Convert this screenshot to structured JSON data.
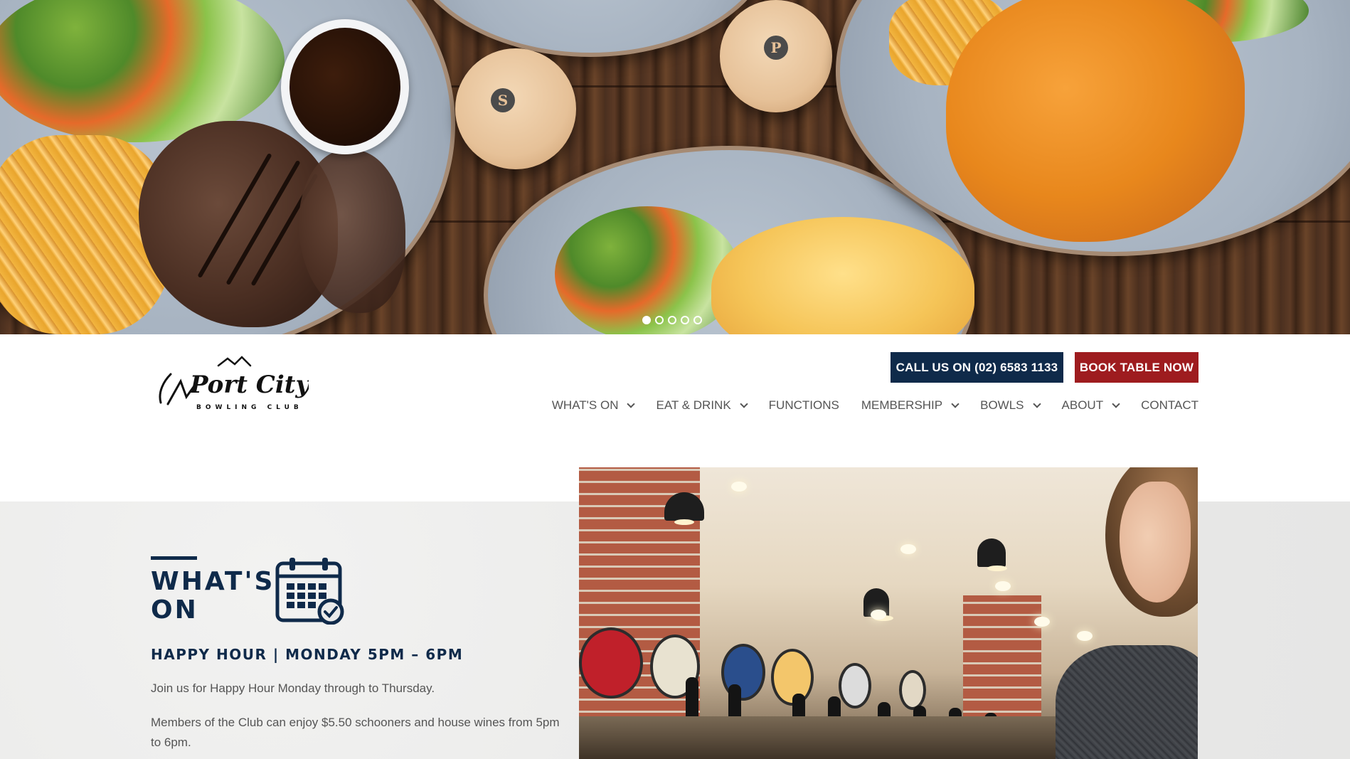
{
  "hero": {
    "slides_count": 5,
    "active_slide": 1
  },
  "header": {
    "logo": {
      "name": "Port City",
      "tagline": "BOWLING CLUB"
    },
    "call_button": "CALL US ON (02) 6583 1133",
    "book_button": "BOOK TABLE NOW",
    "nav": [
      {
        "label": "WHAT'S ON",
        "has_dropdown": true
      },
      {
        "label": "EAT & DRINK",
        "has_dropdown": true
      },
      {
        "label": "FUNCTIONS",
        "has_dropdown": false
      },
      {
        "label": "MEMBERSHIP",
        "has_dropdown": true
      },
      {
        "label": "BOWLS",
        "has_dropdown": true
      },
      {
        "label": "ABOUT",
        "has_dropdown": true
      },
      {
        "label": "CONTACT",
        "has_dropdown": false
      }
    ]
  },
  "whats_on": {
    "title": "WHAT'S ON",
    "icon": "calendar-check-icon",
    "event_title": "HAPPY HOUR | MONDAY 5PM – 6PM",
    "paragraph_1": "Join us for Happy Hour Monday through to Thursday.",
    "paragraph_2": "Members of the Club can enjoy $5.50 schooners and house wines from 5pm to 6pm."
  },
  "colors": {
    "navy": "#0f2a4a",
    "red": "#9e1c1f"
  }
}
